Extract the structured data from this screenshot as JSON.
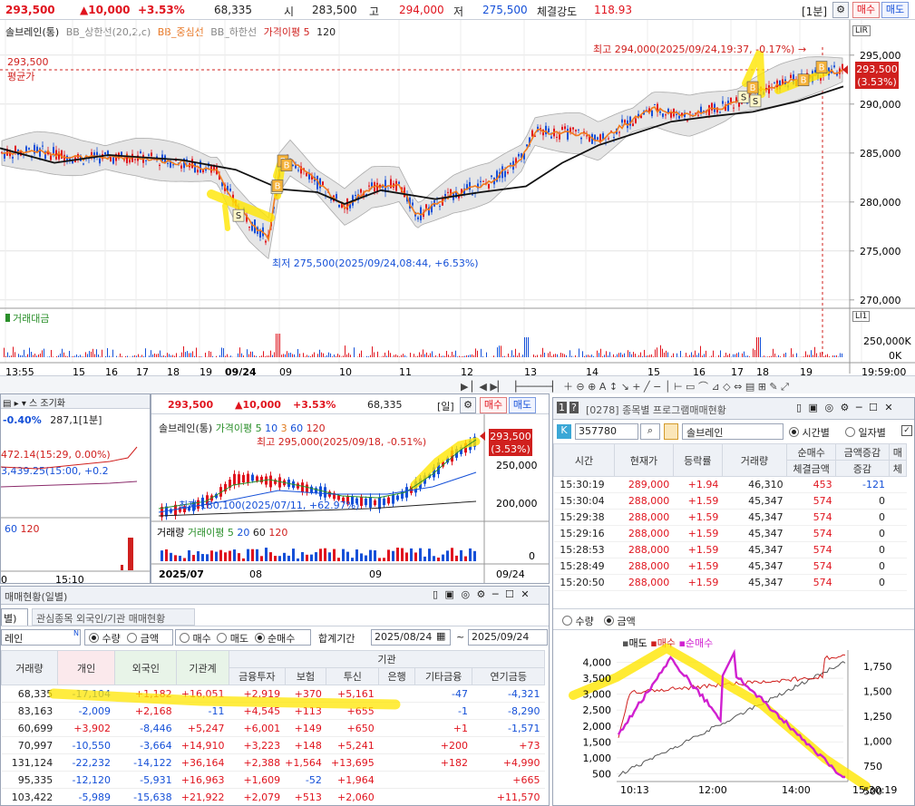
{
  "header": {
    "price": "293,500",
    "change": "▲10,000",
    "change_pct": "+3.53%",
    "volume": "68,335",
    "open_label": "시",
    "open": "283,500",
    "high_label": "고",
    "high": "294,000",
    "low_label": "저",
    "low": "275,500",
    "strength_label": "체결강도",
    "strength": "118.93",
    "interval": "[1분]",
    "buy": "매수",
    "sell": "매도"
  },
  "main_chart": {
    "legend": [
      "솔브레인(통)",
      "BB_상한선(20,2,c)",
      "BB_중심선",
      "BB_하한선",
      "가격이평 5",
      "120"
    ],
    "high_note": "최고 294,000(2025/09/24,19:37, -0.17%)",
    "low_note": "최저 275,500(2025/09/24,08:44, +6.53%)",
    "avg_price": "293,500",
    "avg_label": "평균가",
    "price_tag": "293,500",
    "price_tag_pct": "(3.53%)",
    "y_ticks": [
      "295,000",
      "290,000",
      "285,000",
      "280,000",
      "275,000",
      "270,000"
    ],
    "volume_label": "거래대금",
    "vol_ticks": [
      "250,000K",
      "0K"
    ],
    "x_labels": [
      "13:55",
      "15",
      "16",
      "17",
      "18",
      "19",
      "09/24",
      "09",
      "10",
      "11",
      "12",
      "13",
      "14",
      "15",
      "16",
      "17",
      "18",
      "19",
      "19:59:00"
    ]
  },
  "left_mini": {
    "pct": "-0.40%",
    "price": "287,1[1분]",
    "note1": "472.14(15:29, 0.00%)",
    "note2": "3,439.25(15:00, +0.2",
    "vol_ticks": [
      "60",
      "120"
    ],
    "x": [
      "0",
      "15:10"
    ]
  },
  "daily_chart": {
    "price": "293,500",
    "change": "▲10,000",
    "change_pct": "+3.53%",
    "volume": "68,335",
    "interval": "[일]",
    "buy": "매수",
    "sell": "매도",
    "legend": [
      "솔브레인(통)",
      "가격이평 5",
      "10",
      "3",
      "60",
      "120"
    ],
    "high_note": "최고 295,000(2025/09/18, -0.51%)",
    "low_note": "최저 180,100(2025/07/11, +62.97%)",
    "tag": "293,500",
    "tag_pct": "(3.53%)",
    "y_ticks": [
      "250,000",
      "200,000"
    ],
    "vol_legend": [
      "거래량",
      "거래이평 5",
      "20",
      "60",
      "120"
    ],
    "vol_ticks": [
      "0"
    ],
    "x": [
      "2025/07",
      "08",
      "09",
      "09/24"
    ]
  },
  "program": {
    "code_tag": "[0278] 종목별 프로그램매매현황",
    "code": "357780",
    "name": "솔브레인",
    "mode": [
      "시간별",
      "일자별"
    ],
    "columns": [
      "시간",
      "현재가",
      "등락률",
      "거래량",
      "순매수",
      "금액증감",
      "매"
    ],
    "subcols": [
      "체결금액",
      "증감",
      "체"
    ],
    "rows": [
      [
        "15:30:19",
        "289,000",
        "+1.94",
        "46,310",
        "453",
        "-121"
      ],
      [
        "15:30:04",
        "288,000",
        "+1.59",
        "45,347",
        "574",
        "0"
      ],
      [
        "15:29:38",
        "288,000",
        "+1.59",
        "45,347",
        "574",
        "0"
      ],
      [
        "15:29:16",
        "288,000",
        "+1.59",
        "45,347",
        "574",
        "0"
      ],
      [
        "15:28:53",
        "288,000",
        "+1.59",
        "45,347",
        "574",
        "0"
      ],
      [
        "15:28:49",
        "288,000",
        "+1.59",
        "45,347",
        "574",
        "0"
      ],
      [
        "15:20:50",
        "288,000",
        "+1.59",
        "45,347",
        "574",
        "0"
      ]
    ],
    "chart_mode": [
      "수량",
      "금액"
    ],
    "chart_legend": [
      "매도",
      "매수",
      "순매수"
    ],
    "left_ticks": [
      "4,000",
      "3,500",
      "3,000",
      "2,500",
      "2,000",
      "1,500",
      "1,000",
      "500"
    ],
    "right_ticks": [
      "1,750",
      "1,500",
      "1,250",
      "1,000",
      "750",
      "500"
    ],
    "x": [
      "10:13",
      "12:00",
      "14:00",
      "15:30:19"
    ]
  },
  "investor": {
    "title": "매매현황(일별)",
    "tabs": [
      "별)",
      "관심종목 외국인/기관 매매현황"
    ],
    "stock": "레인",
    "opts1": [
      "수량",
      "금액"
    ],
    "opts2": [
      "매수",
      "매도",
      "순매수"
    ],
    "period_label": "합계기간",
    "from": "2025/08/24",
    "to": "2025/09/24",
    "group_header": "기관",
    "columns": [
      "거래량",
      "개인",
      "외국인",
      "기관계",
      "금융투자",
      "보험",
      "투신",
      "은행",
      "기타금융",
      "연기금등"
    ],
    "rows": [
      [
        "68,335",
        "-17,104",
        "+1,182",
        "+16,051",
        "+2,919",
        "+370",
        "+5,161",
        "",
        "-47",
        "-4,321"
      ],
      [
        "83,163",
        "-2,009",
        "+2,168",
        "-11",
        "+4,545",
        "+113",
        "+655",
        "",
        "-1",
        "-8,290"
      ],
      [
        "60,699",
        "+3,902",
        "-8,446",
        "+5,247",
        "+6,001",
        "+149",
        "+650",
        "",
        "+1",
        "-1,571"
      ],
      [
        "70,997",
        "-10,550",
        "-3,664",
        "+14,910",
        "+3,223",
        "+148",
        "+5,241",
        "",
        "+200",
        "+73"
      ],
      [
        "131,124",
        "-22,232",
        "-14,122",
        "+36,164",
        "+2,388",
        "+1,564",
        "+13,695",
        "",
        "+182",
        "+4,990"
      ],
      [
        "95,335",
        "-12,120",
        "-5,931",
        "+16,963",
        "+1,609",
        "-52",
        "+1,964",
        "",
        "",
        "+665"
      ],
      [
        "103,422",
        "-5,989",
        "-15,638",
        "+21,922",
        "+2,079",
        "+513",
        "+2,060",
        "",
        "",
        "+11,570"
      ]
    ]
  }
}
